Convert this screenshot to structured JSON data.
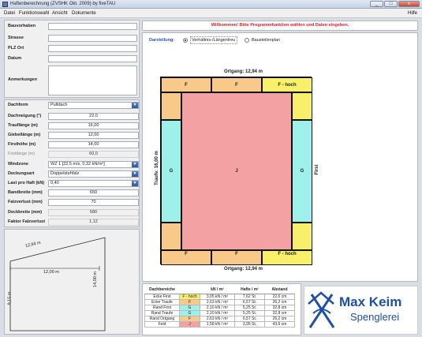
{
  "window": {
    "title": "Haftenberechnung (ZVSHK Okt. 2009) by fiveTAU",
    "minimize": "_",
    "maximize": "□",
    "close": "x"
  },
  "menu": {
    "items": [
      "Datei",
      "Funktionswahl",
      "Ansicht",
      "Dokumente"
    ],
    "help": "Hilfe"
  },
  "address": {
    "bauvorhaben_label": "Bauvorhaben",
    "bauvorhaben_value": "",
    "strasse_label": "Strasse",
    "strasse_value": "",
    "plz_label": "PLZ Ort",
    "plz_value": "",
    "datum_label": "Datum",
    "datum_value": "",
    "anmerkungen_label": "Anmerkungen",
    "anmerkungen_value": ""
  },
  "params": {
    "dachform_label": "Dachform",
    "dachform_value": "Pultdach",
    "dachneigung_label": "Dachneigung (°)",
    "dachneigung_value": "22,0",
    "trauflaenge_label": "Trauflänge (m)",
    "trauflaenge_value": "16,00",
    "giebellaenge_label": "Giebellänge (m)",
    "giebellaenge_value": "12,00",
    "firsthoehe_label": "Firsthöhe (m)",
    "firsthoehe_value": "14,00",
    "firstlaenge_label": "Firstlänge (m)",
    "firstlaenge_value": "60,0",
    "windzone_label": "Windzone",
    "windzone_value": "WZ 1 [22,5 m/s, 0,32 kN/m²]",
    "deckungsart_label": "Deckungsart",
    "deckungsart_value": "Doppelstehfalz",
    "last_label": "Last pro Haft (kN)",
    "last_value": "0,40",
    "bandbreite_label": "Bandbreite (mm)",
    "bandbreite_value": "650",
    "falzverlust_label": "Falzverlust (mm)",
    "falzverlust_value": "70",
    "deckbreite_label": "Deckbreite (mm)",
    "deckbreite_value": "580",
    "faktor_label": "Faktor Falzverlust",
    "faktor_value": "1,12"
  },
  "sketch": {
    "top_length": "12,94 m",
    "base_length": "12,00 m",
    "left_height": "9,15 m",
    "right_height": "14,00 m"
  },
  "banner": {
    "text": "Willkommen! Bitte Programmfunktion wählen und Daten eingeben."
  },
  "view": {
    "label": "Darstellung:",
    "option1": "Verhältnis-/Längentreu",
    "option2": "Bausteilenplan",
    "selected": "Verhältnis-/Längentreu"
  },
  "diagram": {
    "top_label": "Ortgang: 12,94 m",
    "bottom_label": "Ortgang: 12,94 m",
    "left_label": "Traufe: 16,00 m",
    "right_label": "First",
    "zones": {
      "F": "F",
      "F_hoch": "F - hoch",
      "G": "G",
      "J": "J"
    },
    "colors": {
      "orange": "#f9c98a",
      "yellow": "#f9f06a",
      "teal": "#9ef0ea",
      "pink": "#f4a1a3"
    }
  },
  "results": {
    "headers": [
      "Dachbereiche",
      "",
      "kN / m²",
      "Hafte / m²",
      "Abstand"
    ],
    "rows": [
      {
        "name": "Ecke First",
        "zone": "F - hoch",
        "color": "#f9f06a",
        "kn": "3,05 kN / m²",
        "hafte": "7,62 St.",
        "abstand": "22,6 cm"
      },
      {
        "name": "Ecke Traufe",
        "zone": "F",
        "color": "#f9c98a",
        "kn": "2,63 kN / m²",
        "hafte": "6,57 St.",
        "abstand": "26,2 cm"
      },
      {
        "name": "Rand First",
        "zone": "G",
        "color": "#9ef0ea",
        "kn": "2,10 kN / m²",
        "hafte": "5,25 St.",
        "abstand": "32,8 cm"
      },
      {
        "name": "Rand Traufe",
        "zone": "G",
        "color": "#9ef0ea",
        "kn": "2,10 kN / m²",
        "hafte": "5,25 St.",
        "abstand": "32,8 cm"
      },
      {
        "name": "Rand Ortgang",
        "zone": "F",
        "color": "#f9c98a",
        "kn": "2,63 kN / m²",
        "hafte": "6,57 St.",
        "abstand": "26,2 cm"
      },
      {
        "name": "Feld",
        "zone": "J",
        "color": "#f4a1a3",
        "kn": "1,58 kN / m²",
        "hafte": "3,95 St.",
        "abstand": "43,6 cm"
      }
    ]
  },
  "logo": {
    "name": "Max Keim",
    "sub": "Spenglerei",
    "color_name": "#1f4fa8",
    "color_sub": "#1f4fa8"
  }
}
